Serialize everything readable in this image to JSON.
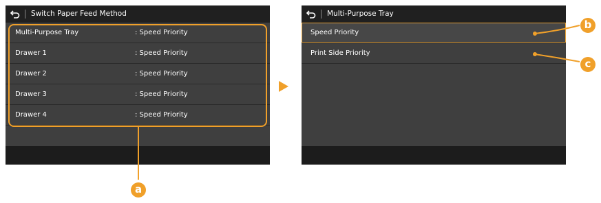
{
  "left_screen": {
    "title": "Switch Paper Feed Method",
    "rows": [
      {
        "label": "Multi-Purpose Tray",
        "value": ": Speed Priority"
      },
      {
        "label": "Drawer 1",
        "value": ": Speed Priority"
      },
      {
        "label": "Drawer 2",
        "value": ": Speed Priority"
      },
      {
        "label": "Drawer 3",
        "value": ": Speed Priority"
      },
      {
        "label": "Drawer 4",
        "value": ": Speed Priority"
      }
    ]
  },
  "right_screen": {
    "title": "Multi-Purpose Tray",
    "options": [
      {
        "label": "Speed Priority"
      },
      {
        "label": "Print Side Priority"
      }
    ]
  },
  "callouts": {
    "a": "a",
    "b": "b",
    "c": "c"
  },
  "colors": {
    "accent": "#f0a02a",
    "screen_bg": "#3f3f3f",
    "titlebar_bg": "#202020",
    "footer_bg": "#1c1c1c"
  },
  "icons": {
    "back": "back-arrow-icon",
    "next": "right-arrow-icon"
  }
}
